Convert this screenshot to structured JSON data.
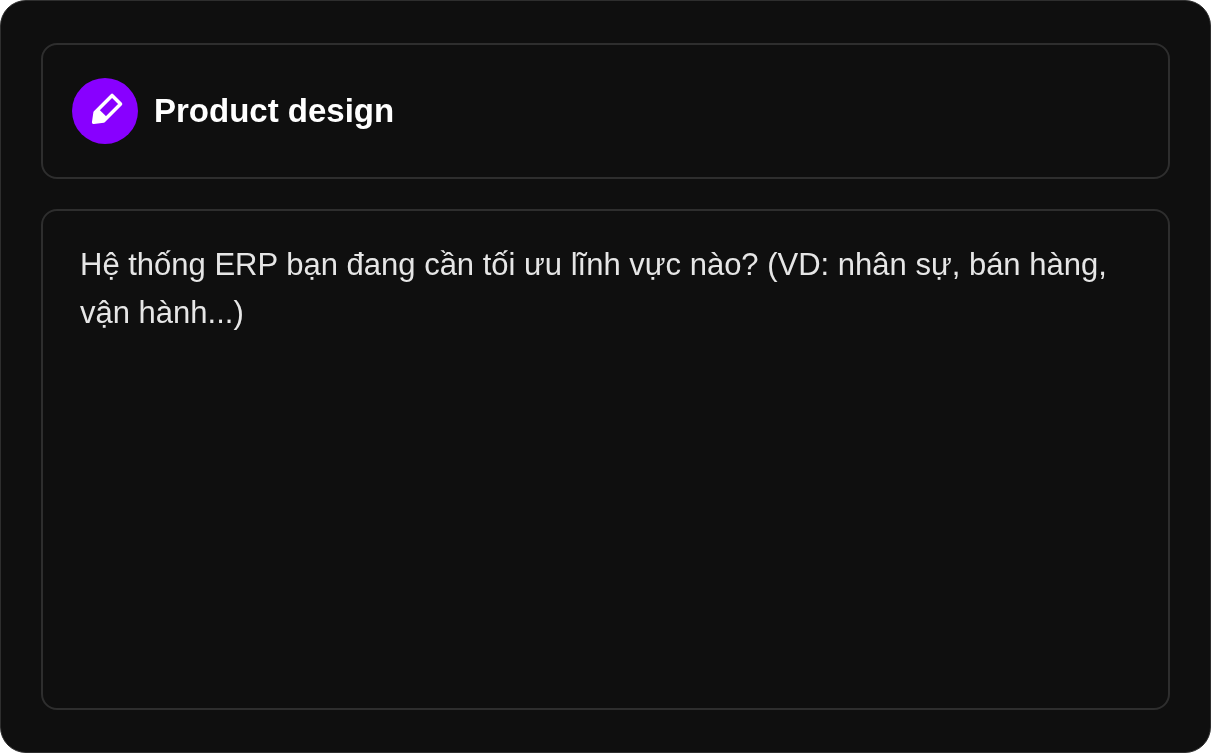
{
  "header": {
    "title": "Product design"
  },
  "answer": {
    "placeholder": "Hệ thống ERP bạn đang cần tối ưu lĩnh vực nào? (VD: nhân sự, bán hàng, vận hành...)"
  }
}
